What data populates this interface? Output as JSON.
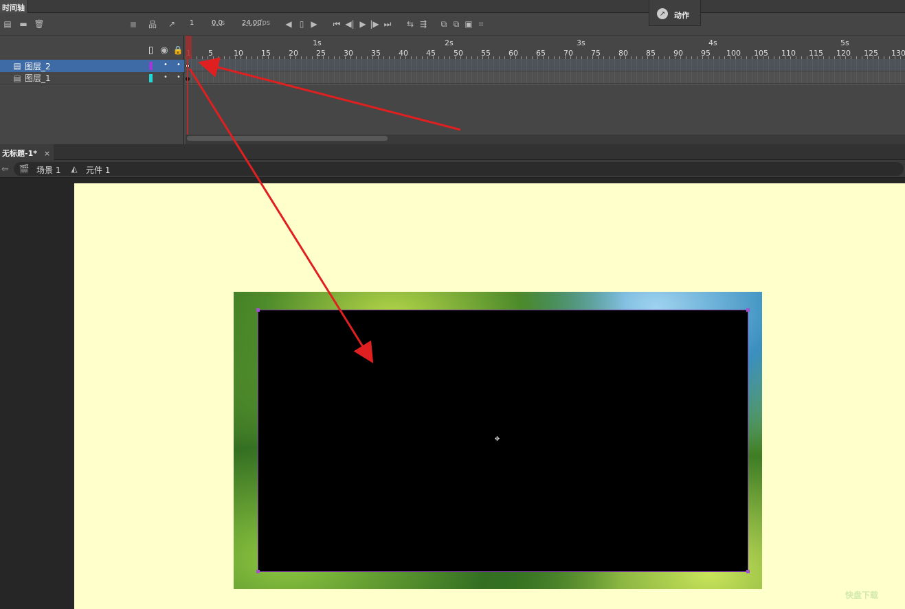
{
  "timeline_tab": {
    "label": "时间轴"
  },
  "toolbar": {
    "frame": "1",
    "time": "0.0",
    "time_unit": "s",
    "fps": "24.00",
    "fps_unit": "fps"
  },
  "actions_panel": {
    "label": "动作"
  },
  "layers": [
    {
      "name": "图层_2",
      "color": "#9b3cd6",
      "selected": true
    },
    {
      "name": "图层_1",
      "color": "#22d6d6",
      "selected": false
    }
  ],
  "ruler": {
    "seconds": [
      "1s",
      "2s",
      "3s",
      "4s",
      "5s"
    ],
    "frames": [
      "1",
      "5",
      "10",
      "15",
      "20",
      "25",
      "30",
      "35",
      "40",
      "45",
      "50",
      "55",
      "60",
      "65",
      "70",
      "75",
      "80",
      "85",
      "90",
      "95",
      "100",
      "105",
      "110",
      "115",
      "120",
      "125",
      "130"
    ]
  },
  "document_tab": {
    "title": "无标题-1*",
    "close": "×"
  },
  "breadcrumb": {
    "scene": "场景 1",
    "symbol": "元件 1"
  },
  "colors": {
    "stage": "#ffffcc",
    "selection": "#3e6aa5",
    "playhead": "#b03030",
    "arrow": "#e02020"
  },
  "watermark": {
    "text": "快盘下载"
  }
}
